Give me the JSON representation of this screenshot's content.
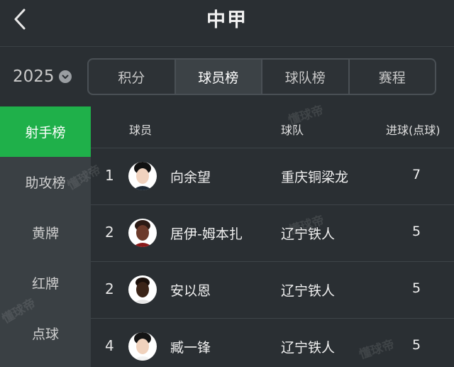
{
  "header": {
    "title": "中甲"
  },
  "toolbar": {
    "season": "2025",
    "tabs": [
      {
        "label": "积分",
        "active": false
      },
      {
        "label": "球员榜",
        "active": true
      },
      {
        "label": "球队榜",
        "active": false
      },
      {
        "label": "赛程",
        "active": false
      }
    ]
  },
  "sidebar": {
    "items": [
      {
        "label": "射手榜",
        "active": true
      },
      {
        "label": "助攻榜",
        "active": false
      },
      {
        "label": "黄牌",
        "active": false
      },
      {
        "label": "红牌",
        "active": false
      },
      {
        "label": "点球",
        "active": false
      }
    ]
  },
  "table": {
    "columns": {
      "player": "球员",
      "team": "球队",
      "goals": "进球(点球)"
    },
    "rows": [
      {
        "rank": "1",
        "name": "向余望",
        "team": "重庆铜梁龙",
        "goals": "7",
        "avatar_skin": "#f1d3bf",
        "avatar_hair": "#111111"
      },
      {
        "rank": "2",
        "name": "居伊-姆本扎",
        "team": "辽宁铁人",
        "goals": "5",
        "avatar_skin": "#6b3a2a",
        "avatar_hair": "#2b1a14"
      },
      {
        "rank": "2",
        "name": "安以恩",
        "team": "辽宁铁人",
        "goals": "5",
        "avatar_skin": "#3b2418",
        "avatar_hair": "#1a0f0a"
      },
      {
        "rank": "4",
        "name": "臧一锋",
        "team": "辽宁铁人",
        "goals": "5",
        "avatar_skin": "#f0d2bd",
        "avatar_hair": "#141414"
      }
    ]
  },
  "watermark": "懂球帝",
  "colors": {
    "accent": "#1fb04a",
    "background": "#2a2f33",
    "sidebar": "#3a4044"
  }
}
